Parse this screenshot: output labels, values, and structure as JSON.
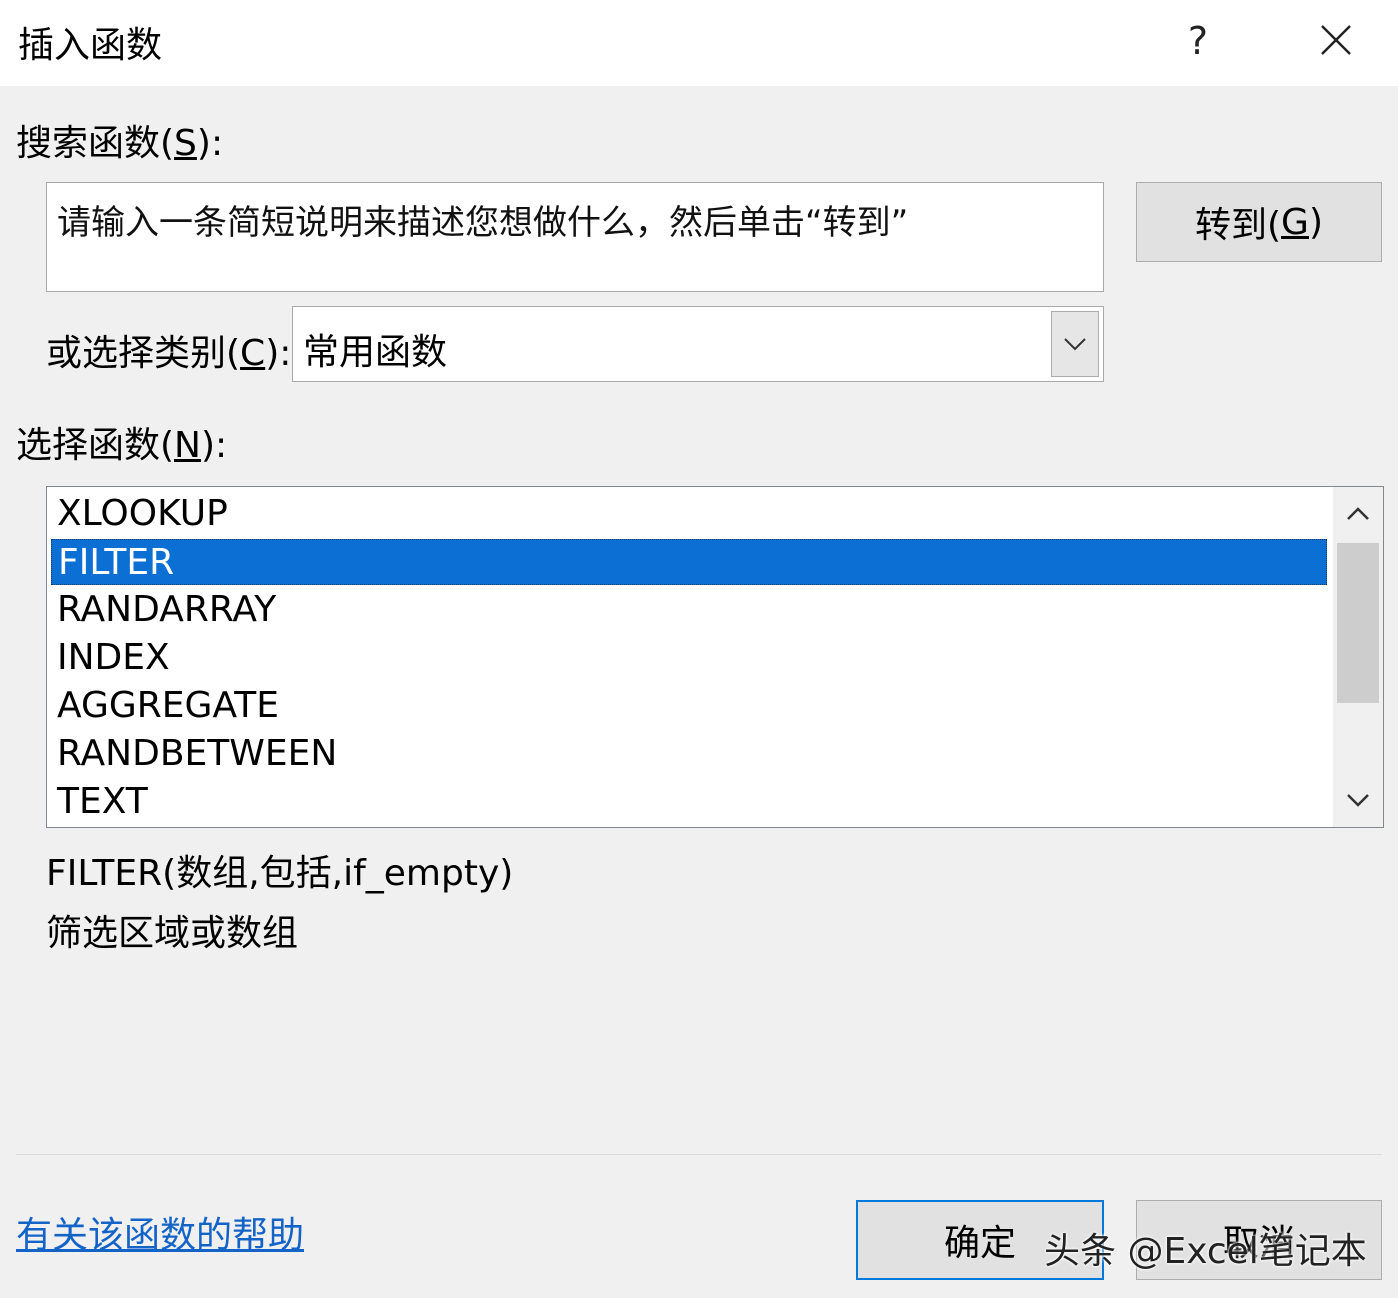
{
  "dialog": {
    "title": "插入函数",
    "help_glyph": "?",
    "close_icon": "close-icon"
  },
  "search": {
    "label_prefix": "搜索函数(",
    "label_key": "S",
    "label_suffix": "):",
    "value": "请输入一条简短说明来描述您想做什么，然后单击“转到”",
    "go_prefix": "转到(",
    "go_key": "G",
    "go_suffix": ")"
  },
  "category": {
    "label_prefix": "或选择类别(",
    "label_key": "C",
    "label_suffix": "):",
    "selected": "常用函数"
  },
  "functions": {
    "label_prefix": "选择函数(",
    "label_key": "N",
    "label_suffix": "):",
    "items": [
      "XLOOKUP",
      "FILTER",
      "RANDARRAY",
      "INDEX",
      "AGGREGATE",
      "RANDBETWEEN",
      "TEXT"
    ],
    "selected": "FILTER"
  },
  "details": {
    "syntax": "FILTER(数组,包括,if_empty)",
    "description": "筛选区域或数组"
  },
  "footer": {
    "help_link": "有关该函数的帮助",
    "ok": "确定",
    "cancel": "取消",
    "watermark": "头条 @Excel笔记本"
  },
  "colors": {
    "selection": "#0b6fd3",
    "link": "#1464c8",
    "ok_border": "#0078d7",
    "background": "#f0f0f0"
  }
}
